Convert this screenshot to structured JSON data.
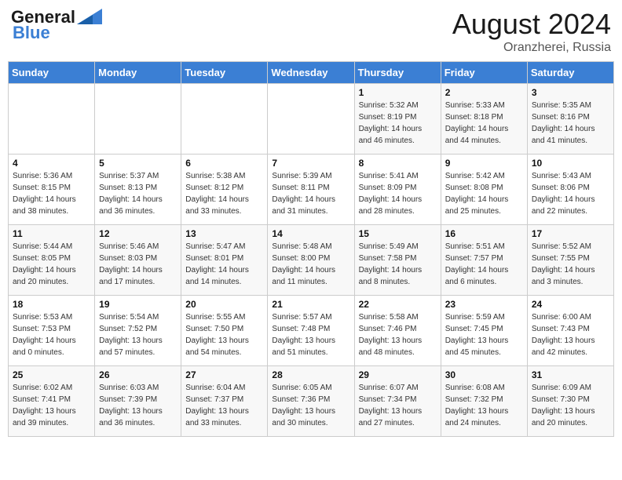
{
  "header": {
    "logo_line1": "General",
    "logo_line2": "Blue",
    "month_year": "August 2024",
    "location": "Oranzherei, Russia"
  },
  "days_of_week": [
    "Sunday",
    "Monday",
    "Tuesday",
    "Wednesday",
    "Thursday",
    "Friday",
    "Saturday"
  ],
  "weeks": [
    [
      {
        "day": "",
        "info": ""
      },
      {
        "day": "",
        "info": ""
      },
      {
        "day": "",
        "info": ""
      },
      {
        "day": "",
        "info": ""
      },
      {
        "day": "1",
        "info": "Sunrise: 5:32 AM\nSunset: 8:19 PM\nDaylight: 14 hours\nand 46 minutes."
      },
      {
        "day": "2",
        "info": "Sunrise: 5:33 AM\nSunset: 8:18 PM\nDaylight: 14 hours\nand 44 minutes."
      },
      {
        "day": "3",
        "info": "Sunrise: 5:35 AM\nSunset: 8:16 PM\nDaylight: 14 hours\nand 41 minutes."
      }
    ],
    [
      {
        "day": "4",
        "info": "Sunrise: 5:36 AM\nSunset: 8:15 PM\nDaylight: 14 hours\nand 38 minutes."
      },
      {
        "day": "5",
        "info": "Sunrise: 5:37 AM\nSunset: 8:13 PM\nDaylight: 14 hours\nand 36 minutes."
      },
      {
        "day": "6",
        "info": "Sunrise: 5:38 AM\nSunset: 8:12 PM\nDaylight: 14 hours\nand 33 minutes."
      },
      {
        "day": "7",
        "info": "Sunrise: 5:39 AM\nSunset: 8:11 PM\nDaylight: 14 hours\nand 31 minutes."
      },
      {
        "day": "8",
        "info": "Sunrise: 5:41 AM\nSunset: 8:09 PM\nDaylight: 14 hours\nand 28 minutes."
      },
      {
        "day": "9",
        "info": "Sunrise: 5:42 AM\nSunset: 8:08 PM\nDaylight: 14 hours\nand 25 minutes."
      },
      {
        "day": "10",
        "info": "Sunrise: 5:43 AM\nSunset: 8:06 PM\nDaylight: 14 hours\nand 22 minutes."
      }
    ],
    [
      {
        "day": "11",
        "info": "Sunrise: 5:44 AM\nSunset: 8:05 PM\nDaylight: 14 hours\nand 20 minutes."
      },
      {
        "day": "12",
        "info": "Sunrise: 5:46 AM\nSunset: 8:03 PM\nDaylight: 14 hours\nand 17 minutes."
      },
      {
        "day": "13",
        "info": "Sunrise: 5:47 AM\nSunset: 8:01 PM\nDaylight: 14 hours\nand 14 minutes."
      },
      {
        "day": "14",
        "info": "Sunrise: 5:48 AM\nSunset: 8:00 PM\nDaylight: 14 hours\nand 11 minutes."
      },
      {
        "day": "15",
        "info": "Sunrise: 5:49 AM\nSunset: 7:58 PM\nDaylight: 14 hours\nand 8 minutes."
      },
      {
        "day": "16",
        "info": "Sunrise: 5:51 AM\nSunset: 7:57 PM\nDaylight: 14 hours\nand 6 minutes."
      },
      {
        "day": "17",
        "info": "Sunrise: 5:52 AM\nSunset: 7:55 PM\nDaylight: 14 hours\nand 3 minutes."
      }
    ],
    [
      {
        "day": "18",
        "info": "Sunrise: 5:53 AM\nSunset: 7:53 PM\nDaylight: 14 hours\nand 0 minutes."
      },
      {
        "day": "19",
        "info": "Sunrise: 5:54 AM\nSunset: 7:52 PM\nDaylight: 13 hours\nand 57 minutes."
      },
      {
        "day": "20",
        "info": "Sunrise: 5:55 AM\nSunset: 7:50 PM\nDaylight: 13 hours\nand 54 minutes."
      },
      {
        "day": "21",
        "info": "Sunrise: 5:57 AM\nSunset: 7:48 PM\nDaylight: 13 hours\nand 51 minutes."
      },
      {
        "day": "22",
        "info": "Sunrise: 5:58 AM\nSunset: 7:46 PM\nDaylight: 13 hours\nand 48 minutes."
      },
      {
        "day": "23",
        "info": "Sunrise: 5:59 AM\nSunset: 7:45 PM\nDaylight: 13 hours\nand 45 minutes."
      },
      {
        "day": "24",
        "info": "Sunrise: 6:00 AM\nSunset: 7:43 PM\nDaylight: 13 hours\nand 42 minutes."
      }
    ],
    [
      {
        "day": "25",
        "info": "Sunrise: 6:02 AM\nSunset: 7:41 PM\nDaylight: 13 hours\nand 39 minutes."
      },
      {
        "day": "26",
        "info": "Sunrise: 6:03 AM\nSunset: 7:39 PM\nDaylight: 13 hours\nand 36 minutes."
      },
      {
        "day": "27",
        "info": "Sunrise: 6:04 AM\nSunset: 7:37 PM\nDaylight: 13 hours\nand 33 minutes."
      },
      {
        "day": "28",
        "info": "Sunrise: 6:05 AM\nSunset: 7:36 PM\nDaylight: 13 hours\nand 30 minutes."
      },
      {
        "day": "29",
        "info": "Sunrise: 6:07 AM\nSunset: 7:34 PM\nDaylight: 13 hours\nand 27 minutes."
      },
      {
        "day": "30",
        "info": "Sunrise: 6:08 AM\nSunset: 7:32 PM\nDaylight: 13 hours\nand 24 minutes."
      },
      {
        "day": "31",
        "info": "Sunrise: 6:09 AM\nSunset: 7:30 PM\nDaylight: 13 hours\nand 20 minutes."
      }
    ]
  ]
}
